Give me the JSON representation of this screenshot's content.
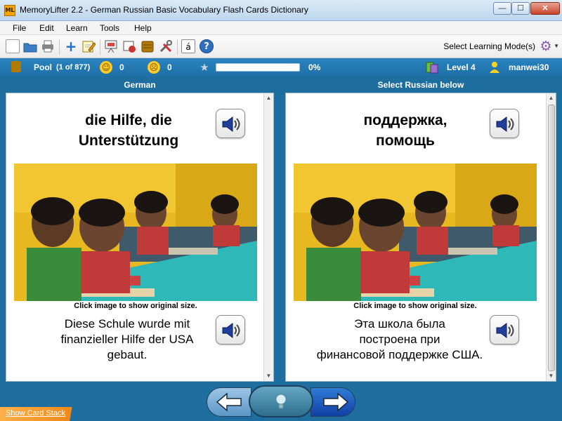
{
  "window": {
    "app_icon": "ML",
    "title": "MemoryLifter 2.2 - German Russian Basic Vocabulary Flash Cards Dictionary",
    "min_glyph": "—",
    "max_glyph": "☐",
    "close_glyph": "✕"
  },
  "menu": {
    "items": [
      "File",
      "Edit",
      "Learn",
      "Tools",
      "Help"
    ]
  },
  "toolbar": {
    "icons": [
      "new-file-icon",
      "open-folder-icon",
      "print-icon",
      "add-card-icon",
      "edit-card-icon",
      "presentation-icon",
      "slideshow-icon",
      "card-box-icon",
      "settings-tools-icon",
      "special-character-icon",
      "help-icon"
    ],
    "special_char_label": "á",
    "help_label": "?",
    "learning_mode_label": "Select Learning Mode(s)"
  },
  "status": {
    "pool_label": "Pool",
    "pool_count": "(1 of 877)",
    "happy_count": "0",
    "sad_count": "0",
    "progress_percent": 0,
    "progress_label": "0%",
    "level_label": "Level 4",
    "user_name": "manwei30",
    "colors": {
      "bar": "#1e6fa6",
      "progress": "#7fcf4a"
    }
  },
  "columns": {
    "left_title": "German",
    "right_title": "Select Russian below"
  },
  "cards": {
    "left": {
      "word_line1": "die Hilfe, die",
      "word_line2": "Unterstützung",
      "image_caption": "Click image to show original size.",
      "sentence_line1": "Diese Schule wurde mit",
      "sentence_line2": "finanzieller Hilfe der USA",
      "sentence_line3": "gebaut."
    },
    "right": {
      "word_line1": "поддержка,",
      "word_line2": "помощь",
      "image_caption": "Click image to show original size.",
      "sentence_line1": "Эта школа была",
      "sentence_line2": "построена при",
      "sentence_line3": "финансовой поддержке США."
    }
  },
  "footer": {
    "show_card_stack": "Show Card Stack"
  }
}
